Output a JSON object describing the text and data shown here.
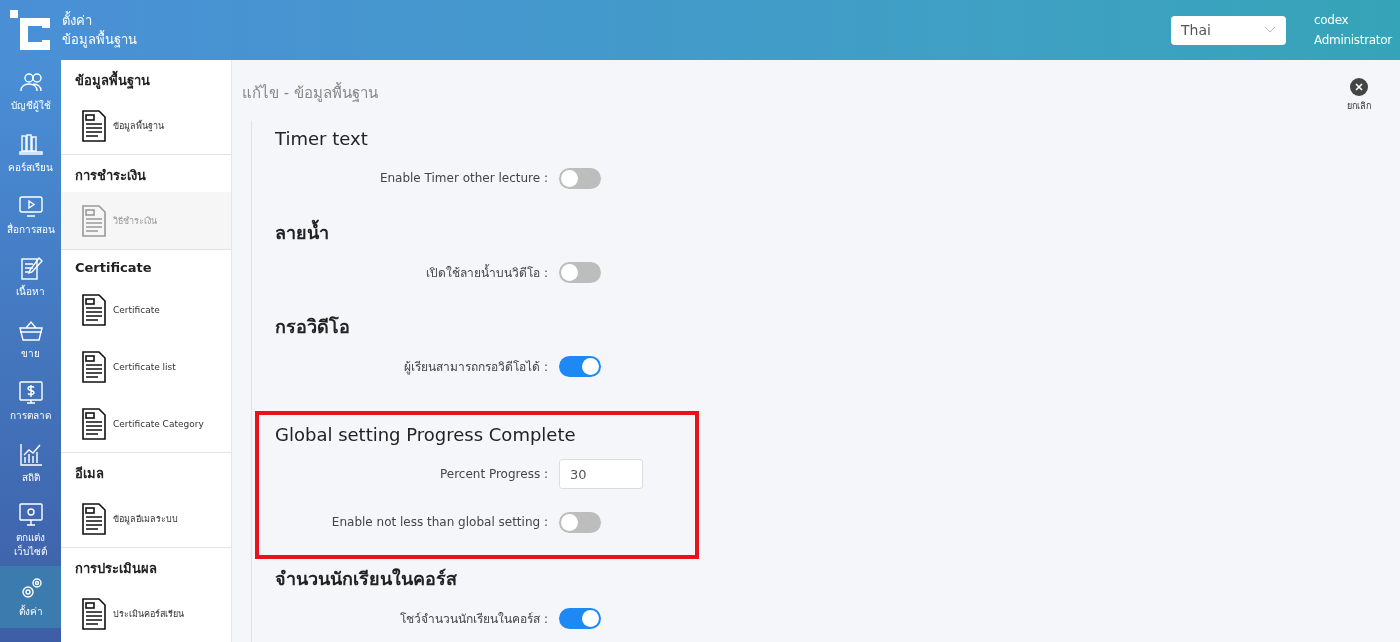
{
  "header": {
    "title_lines": [
      "ตั้งค่า",
      "ข้อมูลพื้นฐาน"
    ],
    "language": "Thai",
    "user": {
      "name": "codex",
      "role": "Administrator"
    }
  },
  "rail": [
    {
      "label": "บัญชีผู้ใช้",
      "selected": false
    },
    {
      "label": "คอร์สเรียน",
      "selected": false
    },
    {
      "label": "สื่อการสอน",
      "selected": false
    },
    {
      "label": "เนื้อหา",
      "selected": false
    },
    {
      "label": "ขาย",
      "selected": false
    },
    {
      "label": "การตลาด",
      "selected": false
    },
    {
      "label": "สถิติ",
      "selected": false
    },
    {
      "label": "ตกแต่ง\nเว็บไซต์",
      "selected": false
    },
    {
      "label": "ตั้งค่า",
      "selected": true
    }
  ],
  "menu": [
    {
      "title": "ข้อมูลพื้นฐาน",
      "items": [
        {
          "label": "ข้อมูลพื้นฐาน",
          "disabled": false
        }
      ]
    },
    {
      "title": "การชำระเงิน",
      "items": [
        {
          "label": "วิธีชำระเงิน",
          "disabled": true
        }
      ]
    },
    {
      "title": "Certificate",
      "items": [
        {
          "label": "Certificate",
          "disabled": false
        },
        {
          "label": "Certificate list",
          "disabled": false
        },
        {
          "label": "Certificate Category",
          "disabled": false
        }
      ]
    },
    {
      "title": "อีเมล",
      "items": [
        {
          "label": "ข้อมูลอีเมลระบบ",
          "disabled": false
        }
      ]
    },
    {
      "title": "การประเมินผล",
      "items": [
        {
          "label": "ประเมินคอร์สเรียน",
          "disabled": false
        }
      ]
    }
  ],
  "page_title": "แก้ไข - ข้อมูลพื้นฐาน",
  "cancel_button": "ยกเลิก",
  "sections": [
    {
      "title": "Timer text",
      "highlighted": false,
      "fields": [
        {
          "kind": "toggle",
          "label": "Enable Timer other lecture :",
          "on": false
        }
      ]
    },
    {
      "title": "ลายน้ำ",
      "highlighted": false,
      "fields": [
        {
          "kind": "toggle",
          "label": "เปิดใช้ลายน้ำบนวิดีโอ :",
          "on": false
        }
      ]
    },
    {
      "title": "กรอวิดีโอ",
      "highlighted": false,
      "fields": [
        {
          "kind": "toggle",
          "label": "ผู้เรียนสามารถกรอวิดีโอได้ :",
          "on": true
        }
      ]
    },
    {
      "title": "Global setting Progress Complete",
      "highlighted": true,
      "fields": [
        {
          "kind": "input",
          "label": "Percent Progress :",
          "value": "30"
        },
        {
          "kind": "toggle",
          "label": "Enable not less than global setting :",
          "on": false
        }
      ]
    },
    {
      "title": "จำนวนนักเรียนในคอร์ส",
      "highlighted": false,
      "fields": [
        {
          "kind": "toggle",
          "label": "โชว์จำนวนนักเรียนในคอร์ส :",
          "on": true
        }
      ]
    }
  ]
}
